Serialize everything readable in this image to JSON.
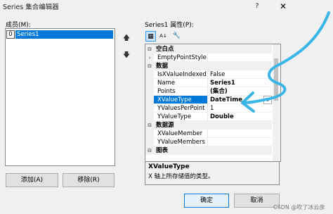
{
  "window": {
    "title": "Series 集合编辑器",
    "help_glyph": "?",
    "close_glyph": "✕"
  },
  "members": {
    "label": "成员(M):",
    "items": [
      {
        "index": "0",
        "name": "Series1"
      }
    ]
  },
  "move_up": "🡅",
  "move_down": "🡇",
  "buttons": {
    "add": "添加(A)",
    "remove": "移除(R)",
    "ok": "确定",
    "cancel": "取消"
  },
  "properties": {
    "label": "Series1 属性(P):",
    "toolbar": {
      "categorized_glyph": "▦",
      "alphabetical_glyph": "A↓",
      "pages_glyph": "🔧"
    },
    "rows": [
      {
        "kind": "category",
        "gutter": "⊟",
        "name": "空白点"
      },
      {
        "kind": "prop",
        "gutter": "›",
        "name": "EmptyPointStyle",
        "value": ""
      },
      {
        "kind": "category",
        "gutter": "⊟",
        "name": "数据"
      },
      {
        "kind": "prop",
        "gutter": "",
        "name": "IsXValueIndexed",
        "value": "False",
        "bold": false
      },
      {
        "kind": "prop",
        "gutter": "",
        "name": "Name",
        "value": "Series1",
        "bold": true
      },
      {
        "kind": "prop",
        "gutter": "",
        "name": "Points",
        "value": "(集合)",
        "bold": true
      },
      {
        "kind": "prop",
        "gutter": "",
        "name": "XValueType",
        "value": "DateTime",
        "bold": true,
        "selected": true
      },
      {
        "kind": "prop",
        "gutter": "",
        "name": "YValuesPerPoint",
        "value": "1",
        "bold": false
      },
      {
        "kind": "prop",
        "gutter": "",
        "name": "YValueType",
        "value": "Double",
        "bold": true
      },
      {
        "kind": "category",
        "gutter": "⊟",
        "name": "数据源"
      },
      {
        "kind": "prop",
        "gutter": "",
        "name": "XValueMember",
        "value": ""
      },
      {
        "kind": "prop",
        "gutter": "",
        "name": "YValueMembers",
        "value": ""
      },
      {
        "kind": "category",
        "gutter": "⊟",
        "name": "图表"
      }
    ],
    "dropdown_glyph": "⌄"
  },
  "description": {
    "title": "XValueType",
    "text": "X 轴上所存储值的类型。"
  },
  "watermark": "CSDN @吹了冰云彦",
  "colors": {
    "selection": "#0078d7",
    "annotation": "#3bb4e6"
  }
}
